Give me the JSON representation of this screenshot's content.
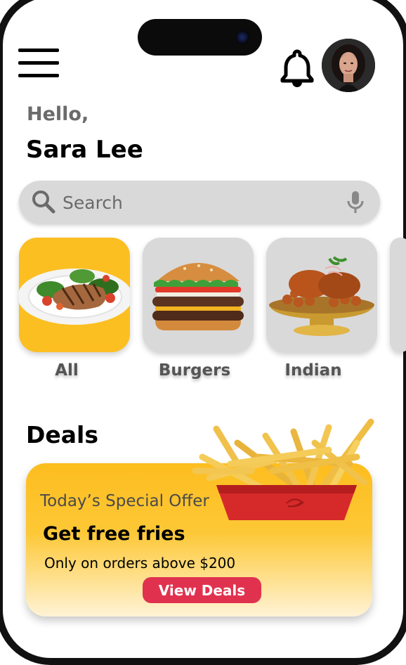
{
  "header": {
    "menu_icon": "hamburger-menu-icon",
    "notification_icon": "bell-icon",
    "avatar_icon": "user-avatar"
  },
  "greeting": {
    "hello": "Hello,",
    "name": "Sara Lee"
  },
  "search": {
    "placeholder": "Search",
    "value": "",
    "left_icon": "search-icon",
    "right_icon": "microphone-icon"
  },
  "categories": [
    {
      "label": "All",
      "image": "grilled-steak-plate",
      "selected": true
    },
    {
      "label": "Burgers",
      "image": "burger",
      "selected": false
    },
    {
      "label": "Indian",
      "image": "indian-dish",
      "selected": false
    }
  ],
  "deals": {
    "title": "Deals",
    "card": {
      "subtitle": "Today’s Special Offer",
      "headline": "Get free fries",
      "description": "Only on orders above $200",
      "button_label": "View Deals",
      "image": "fries-box"
    }
  },
  "colors": {
    "accent_yellow": "#fcbf22",
    "button_red": "#e0324f",
    "card_grey": "#d9d9d9",
    "text_grey": "#6b6b6b"
  }
}
